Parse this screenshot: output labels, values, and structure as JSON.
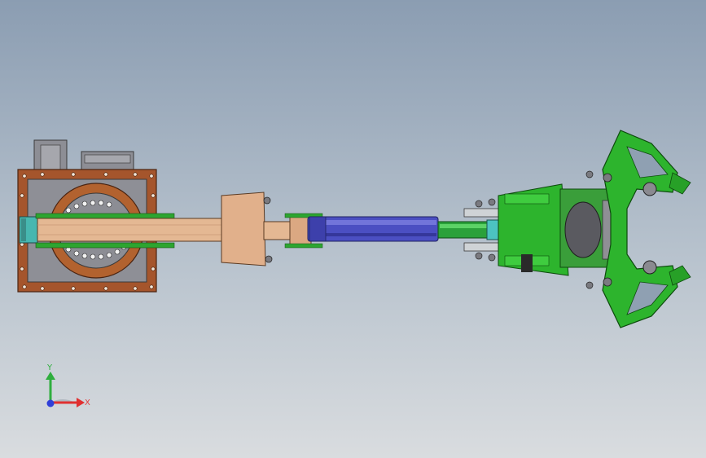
{
  "viewport": {
    "background_top": "#8b9db2",
    "background_bottom": "#d9dcdf"
  },
  "triad": {
    "x_label": "X",
    "y_label": "Y",
    "x_color": "#e03030",
    "y_color": "#2fae3e",
    "z_color": "#2f3fd8"
  },
  "model": {
    "base_color": "#a5552c",
    "arm_color": "#e2b48e",
    "cylinder_color": "#4b4fc2",
    "rod_color": "#2aa13a",
    "gripper_color": "#2db42d",
    "motor_color": "#8f8f95"
  }
}
